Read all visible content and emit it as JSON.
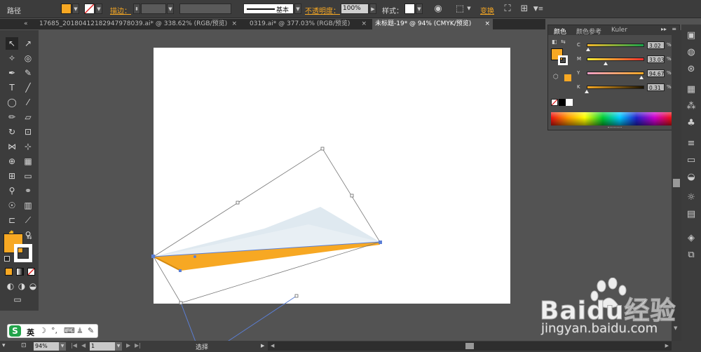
{
  "control_bar": {
    "path_label": "路径",
    "fill_color": "#f7a823",
    "stroke_label": "描边：",
    "stroke_style": "基本",
    "opacity_label": "不透明度：",
    "opacity_value": "100%",
    "style_label": "样式：",
    "transform_label": "变换"
  },
  "tabs": [
    {
      "label": "17685_20180412182947978039.ai* @ 338.62% (RGB/预览)",
      "close": "×"
    },
    {
      "label": "0319.ai* @ 377.03% (RGB/预览)",
      "close": "×"
    },
    {
      "label": "未标题-19* @ 94% (CMYK/预览)",
      "close": "×"
    }
  ],
  "tabs_overflow": "«",
  "color_panel": {
    "tabs": [
      "颜色",
      "颜色参考",
      "Kuler"
    ],
    "channels": [
      {
        "label": "C",
        "value": "3.02",
        "unit": "%",
        "level": 0.0302
      },
      {
        "label": "M",
        "value": "33.03",
        "unit": "%",
        "level": 0.3303
      },
      {
        "label": "Y",
        "value": "94.67",
        "unit": "%",
        "level": 0.9467
      },
      {
        "label": "K",
        "value": "0.31",
        "unit": "%",
        "level": 0.0031
      }
    ]
  },
  "status_bar": {
    "zoom": "94%",
    "artboard_num": "1",
    "tool": "选择"
  },
  "ime_bar": {
    "logo": "S",
    "lang": "英"
  },
  "watermark": {
    "brand": "Baidu经验",
    "url": "jingyan.baidu.com"
  },
  "colors": {
    "accent_orange": "#f7a823",
    "shape_fill": "#dde9f0",
    "selection_blue": "#5b7fd6"
  }
}
